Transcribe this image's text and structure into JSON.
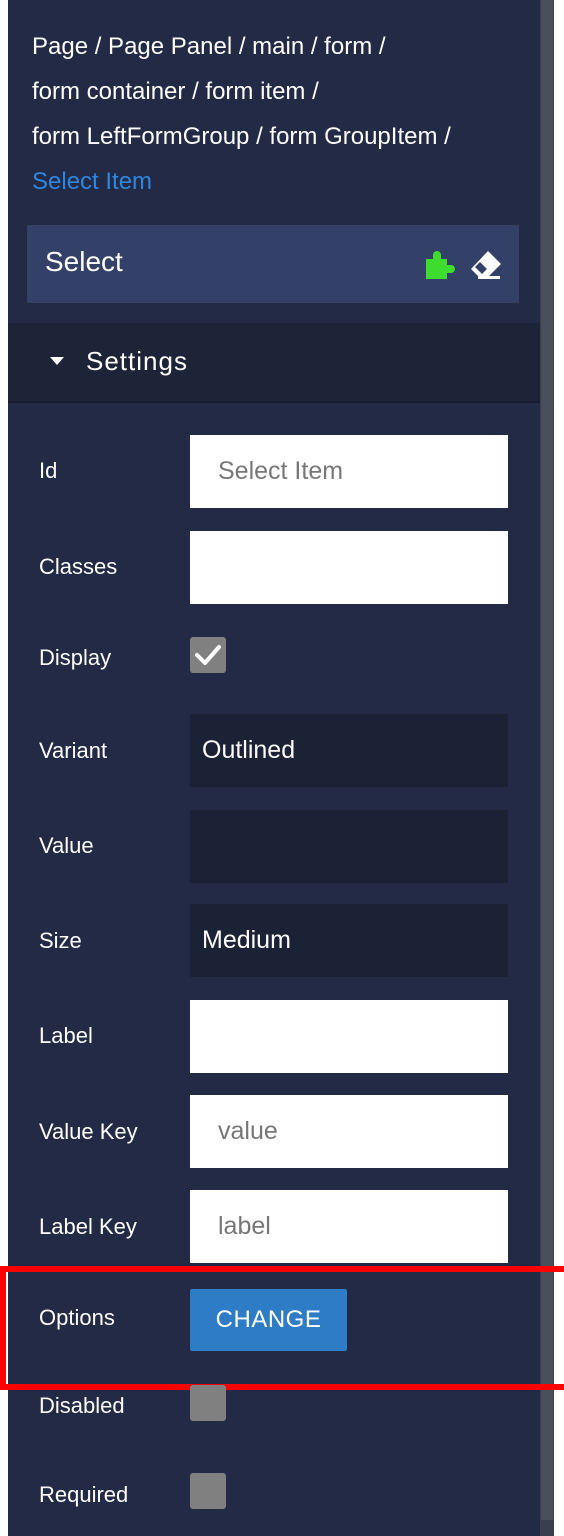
{
  "breadcrumb": {
    "line1": "Page / Page Panel / main / form /",
    "line2": "form container / form item /",
    "line3": "form LeftFormGroup / form GroupItem /",
    "current": "Select Item"
  },
  "component": {
    "title": "Select",
    "icons": [
      "puzzle-icon",
      "eraser-icon"
    ]
  },
  "settings": {
    "label": "Settings",
    "rows": {
      "id": {
        "label": "Id",
        "value": "",
        "placeholder": "Select Item"
      },
      "classes": {
        "label": "Classes",
        "value": ""
      },
      "display": {
        "label": "Display",
        "checked": true
      },
      "variant": {
        "label": "Variant",
        "value": "Outlined"
      },
      "value": {
        "label": "Value",
        "value": ""
      },
      "size": {
        "label": "Size",
        "value": "Medium"
      },
      "label": {
        "label": "Label",
        "value": ""
      },
      "value_key": {
        "label": "Value Key",
        "value": "",
        "placeholder": "value"
      },
      "label_key": {
        "label": "Label Key",
        "value": "",
        "placeholder": "label"
      },
      "options": {
        "label": "Options",
        "button": "CHANGE"
      },
      "disabled": {
        "label": "Disabled",
        "checked": false
      },
      "required": {
        "label": "Required",
        "checked": false
      }
    }
  },
  "colors": {
    "panel_bg": "#222a45",
    "header_bg": "#334169",
    "accent_link": "#2f86de",
    "button_bg": "#2e7bc6",
    "highlight": "#ff0000",
    "puzzle_icon": "#3ddc2f"
  }
}
